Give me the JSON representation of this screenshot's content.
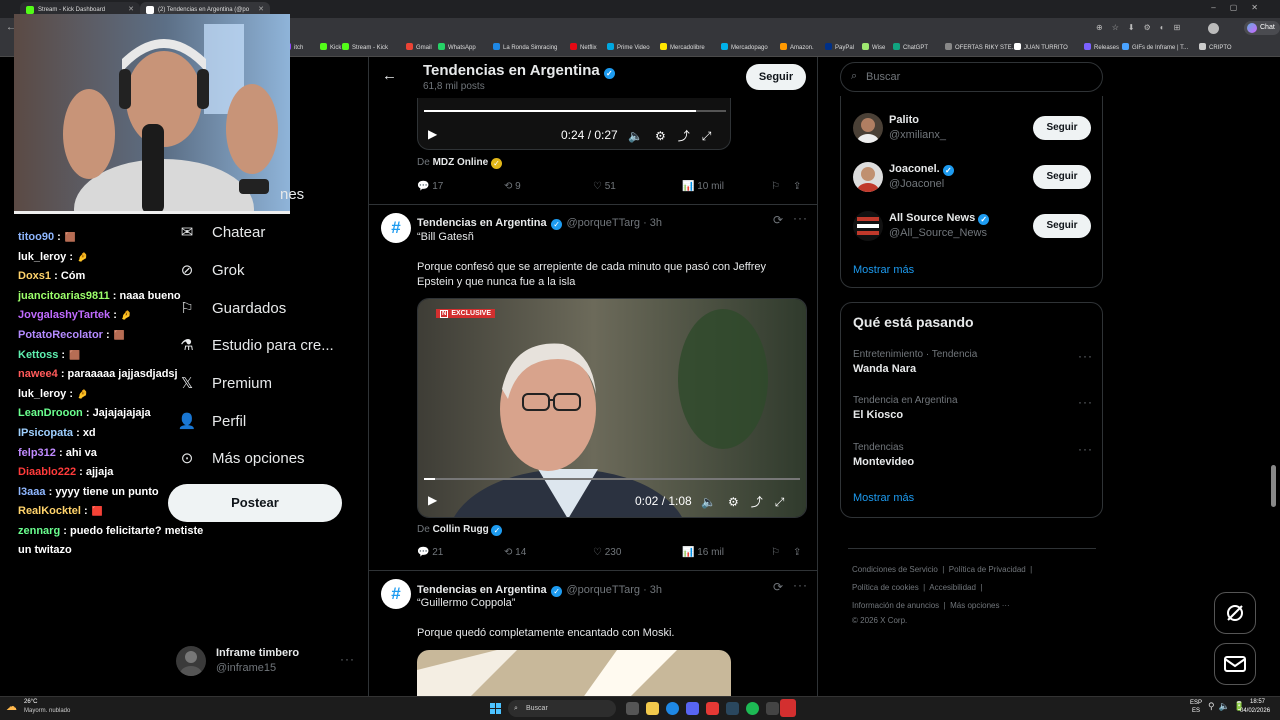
{
  "browser": {
    "tabs": [
      {
        "label": "Stream - Kick Dashboard",
        "color": "#53fc18"
      },
      {
        "label": "(2) Tendencias en Argentina (@po",
        "color": "#ffffff"
      }
    ],
    "profile_label": "Chat",
    "bookmarks": [
      {
        "label": "itch",
        "color": "#9146ff"
      },
      {
        "label": "Kick",
        "color": "#53fc18"
      },
      {
        "label": "Stream - Kick",
        "color": "#53fc18"
      },
      {
        "label": "Gmail",
        "color": "#ea4335"
      },
      {
        "label": "WhatsApp",
        "color": "#25d366"
      },
      {
        "label": "La Ronda Simracing",
        "color": "#1e88e5"
      },
      {
        "label": "Netflix",
        "color": "#e50914"
      },
      {
        "label": "Prime Video",
        "color": "#00a8e1"
      },
      {
        "label": "Mercadolibre",
        "color": "#ffe600"
      },
      {
        "label": "Mercadopago",
        "color": "#00b1ea"
      },
      {
        "label": "Amazon.",
        "color": "#ff9900"
      },
      {
        "label": "PayPal",
        "color": "#003087"
      },
      {
        "label": "Wise",
        "color": "#9fe870"
      },
      {
        "label": "ChatGPT",
        "color": "#10a37f"
      },
      {
        "label": "OFERTAS RIKY STE...",
        "color": "#888888"
      },
      {
        "label": "JUAN TURRITO",
        "color": "#ffffff"
      },
      {
        "label": "Releases",
        "color": "#7b61ff"
      },
      {
        "label": "GIFs de Inframe | T...",
        "color": "#4aa3ff"
      },
      {
        "label": "CRIPTO",
        "color": "#cccccc"
      }
    ]
  },
  "chat": {
    "messages": [
      {
        "user": "titoo90",
        "color": "#8fb7ff",
        "text": ":",
        "emote": "🟫"
      },
      {
        "user": "luk_leroy",
        "color": "#ffffff",
        "text": ":",
        "emote": "🤌"
      },
      {
        "user": "Doxs1",
        "color": "#ffd36b",
        "text": ": Cóm",
        "emote": ""
      },
      {
        "user": "juancitoarias9811",
        "color": "#9cff6b",
        "text": ": naaa bueno",
        "emote": ""
      },
      {
        "user": "JovgalashyTartek",
        "color": "#c06bff",
        "text": ":",
        "emote": "🤌"
      },
      {
        "user": "PotatoRecolator",
        "color": "#b48bff",
        "text": ":",
        "emote": "🟫"
      },
      {
        "user": "Kettoss",
        "color": "#5ff0b0",
        "text": ":",
        "emote": "🟫"
      },
      {
        "user": "nawee4",
        "color": "#ff5a5a",
        "text": ": paraaaaa jajjasdjadsj",
        "emote": ""
      },
      {
        "user": "luk_leroy",
        "color": "#ffffff",
        "text": ":",
        "emote": "🤌"
      },
      {
        "user": "LeanDrooon",
        "color": "#6bff8f",
        "text": ": Jajajajajaja",
        "emote": ""
      },
      {
        "user": "IPsicopata",
        "color": "#9fd0ff",
        "text": ": xd",
        "emote": ""
      },
      {
        "user": "felp312",
        "color": "#c08bff",
        "text": ": ahi va",
        "emote": ""
      },
      {
        "user": "Diaablo222",
        "color": "#ff3b3b",
        "text": ": ajjaja",
        "emote": ""
      },
      {
        "user": "l3aaa",
        "color": "#8fb7ff",
        "text": ": yyyy tiene un punto",
        "emote": ""
      },
      {
        "user": "RealKocktel",
        "color": "#ffd36b",
        "text": ":",
        "emote": "🟥"
      },
      {
        "user": "zennarg",
        "color": "#6bff8f",
        "text": ": puedo felicitarte? metiste",
        "emote": ""
      }
    ],
    "continuation": "un twitazo"
  },
  "nav": {
    "items": [
      {
        "label": "Chatear",
        "icon": "mail-icon"
      },
      {
        "label": "Grok",
        "icon": "grok-icon"
      },
      {
        "label": "Guardados",
        "icon": "bookmark-icon"
      },
      {
        "label": "Estudio para cre...",
        "icon": "flask-icon"
      },
      {
        "label": "Premium",
        "icon": "x-logo-icon"
      },
      {
        "label": "Perfil",
        "icon": "person-icon"
      },
      {
        "label": "Más opciones",
        "icon": "more-circle-icon"
      }
    ],
    "partial_label": "nes",
    "post_label": "Postear",
    "account": {
      "name": "Inframe timbero",
      "handle": "@inframe15"
    }
  },
  "header": {
    "title": "Tendencias en Argentina",
    "subtitle": "61,8 mil posts",
    "follow_label": "Seguir"
  },
  "tweets": [
    {
      "video": {
        "time": "0:24 / 0:27"
      },
      "source_prefix": "De",
      "source": "MDZ Online",
      "stats": {
        "replies": "17",
        "reposts": "9",
        "likes": "51",
        "views": "10 mil"
      }
    },
    {
      "name": "Tendencias en Argentina",
      "handle": "@porqueTTarg · 3h",
      "quote": "“Bill Gatesñ",
      "text": "Porque confesó que se arrepiente de cada minuto que pasó con Jeffrey Epstein y que nunca fue a la isla",
      "video": {
        "time": "0:02 / 1:08",
        "badge": "EXCLUSIVE",
        "progress": 0.03
      },
      "source_prefix": "De",
      "source": "Collin Rugg",
      "stats": {
        "replies": "21",
        "reposts": "14",
        "likes": "230",
        "views": "16 mil"
      }
    },
    {
      "name": "Tendencias en Argentina",
      "handle": "@porqueTTarg · 3h",
      "quote": "“Guillermo Coppola”",
      "text": "Porque quedó completamente encantado con Moski."
    }
  ],
  "right": {
    "search_placeholder": "Buscar",
    "who_to_follow": [
      {
        "name": "Palito",
        "handle": "@xmilianx_",
        "verified": false
      },
      {
        "name": "Joaconel.",
        "handle": "@Joaconel",
        "verified": true
      },
      {
        "name": "All Source News",
        "handle": "@All_Source_News",
        "verified": true
      }
    ],
    "follow_label": "Seguir",
    "show_more": "Mostrar más",
    "trending_title": "Qué está pasando",
    "trends": [
      {
        "meta": "Entretenimiento · Tendencia",
        "name": "Wanda Nara"
      },
      {
        "meta": "Tendencia en Argentina",
        "name": "El Kiosco"
      },
      {
        "meta": "Tendencias",
        "name": "Montevideo"
      }
    ],
    "show_more_2": "Mostrar más",
    "footer": {
      "l1": [
        "Condiciones de Servicio",
        "Política de Privacidad"
      ],
      "l2": [
        "Política de cookies",
        "Accesibilidad"
      ],
      "l3": [
        "Información de anuncios",
        "Más opciones ···"
      ],
      "copyright": "© 2026 X Corp."
    }
  },
  "taskbar": {
    "weather_temp": "26°C",
    "weather_desc": "Mayorm. nublado",
    "search": "Buscar",
    "lang1": "ESP",
    "lang2": "ES",
    "time": "18:57",
    "date": "04/02/2026"
  }
}
